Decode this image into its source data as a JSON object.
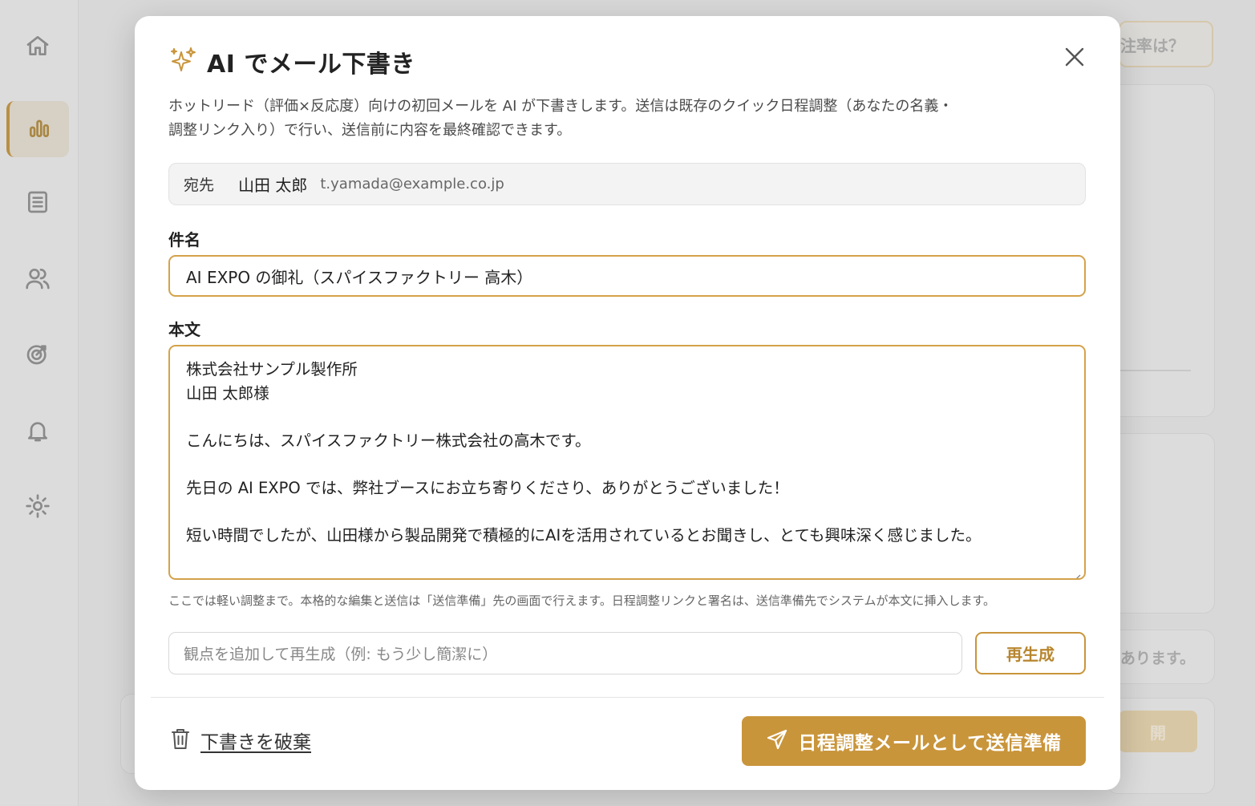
{
  "background": {
    "chip_text": "注率は？",
    "side_text": "あります。",
    "side_button": "開"
  },
  "sidebar": {
    "items": [
      {
        "icon": "home-icon"
      },
      {
        "icon": "bar-chart-icon",
        "active": true
      },
      {
        "icon": "list-icon"
      },
      {
        "icon": "users-icon"
      },
      {
        "icon": "target-icon"
      },
      {
        "icon": "bell-icon"
      },
      {
        "icon": "gear-icon"
      }
    ]
  },
  "modal": {
    "title": "AI でメール下書き",
    "description_line1": "ホットリード（評価×反応度）向けの初回メールを AI が下書きします。送信は既存のクイック日程調整（あなたの名義・",
    "description_line2": "調整リンク入り）で行い、送信前に内容を最終確認できます。",
    "recipient": {
      "label": "宛先",
      "name": "山田 太郎",
      "email": "t.yamada@example.co.jp"
    },
    "subject": {
      "label": "件名",
      "value": "AI EXPO の御礼（スパイスファクトリー 高木）"
    },
    "body": {
      "label": "本文",
      "lines": [
        "株式会社サンプル製作所",
        "山田 太郎様",
        "",
        "こんにちは、スパイスファクトリー株式会社の高木です。",
        "",
        "先日の AI EXPO では、弊社ブースにお立ち寄りくださり、ありがとうございました！",
        "",
        "短い時間でしたが、山田様から製品開発で積極的にAIを活用されているとお聞きし、とても興味深く感じました。"
      ]
    },
    "hint": "ここでは軽い調整まで。本格的な編集と送信は「送信準備」先の画面で行えます。日程調整リンクと署名は、送信準備先でシステムが本文に挿入します。",
    "regenerate": {
      "placeholder": "観点を追加して再生成（例: もう少し簡潔に）",
      "button_label": "再生成"
    },
    "discard_label": "下書きを破棄",
    "send_label": "日程調整メールとして送信準備"
  },
  "colors": {
    "accent": "#c9953b",
    "accent_border": "#d4a24a"
  }
}
